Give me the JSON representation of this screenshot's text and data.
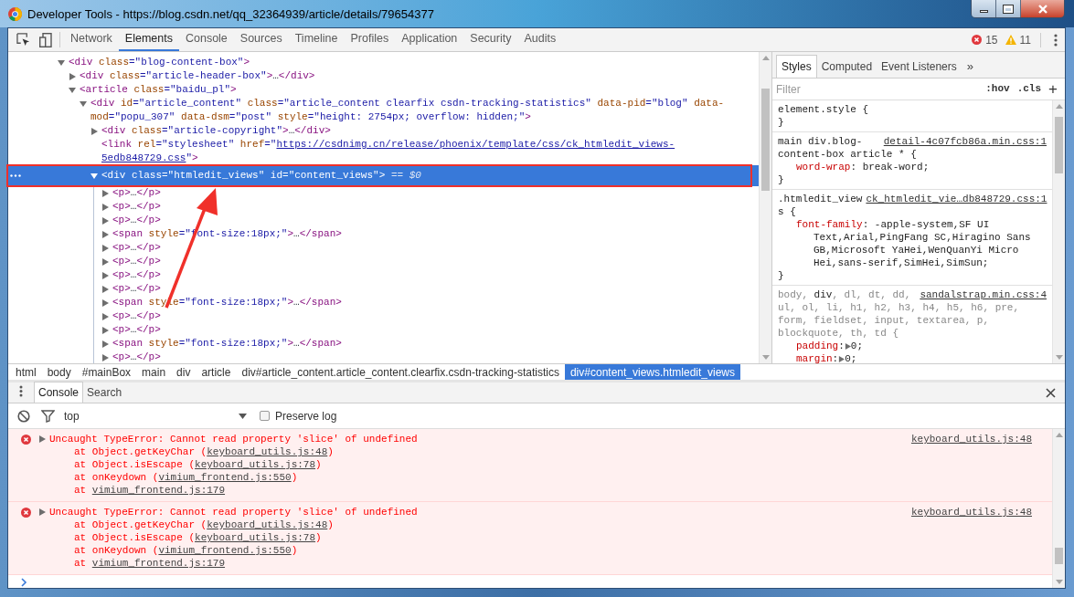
{
  "window": {
    "title": "Developer Tools - https://blog.csdn.net/qq_32364939/article/details/79654377"
  },
  "toolbar": {
    "tabs": [
      {
        "label": "Network",
        "selected": false
      },
      {
        "label": "Elements",
        "selected": true
      },
      {
        "label": "Console",
        "selected": false
      },
      {
        "label": "Sources",
        "selected": false
      },
      {
        "label": "Timeline",
        "selected": false
      },
      {
        "label": "Profiles",
        "selected": false
      },
      {
        "label": "Application",
        "selected": false
      },
      {
        "label": "Security",
        "selected": false
      },
      {
        "label": "Audits",
        "selected": false
      }
    ],
    "errors": "15",
    "warnings": "11"
  },
  "dom_tree": [
    {
      "expanded": true,
      "selected": false,
      "parts": [
        {
          "kind": "tag",
          "text": "<div"
        },
        {
          "kind": "attr",
          "text": " class"
        },
        {
          "kind": "value",
          "text": "=\"blog-content-box\""
        },
        {
          "kind": "tag",
          "text": ">"
        }
      ],
      "children": [
        {
          "expanded": false,
          "selected": false,
          "parts": [
            {
              "kind": "tag",
              "text": "<div"
            },
            {
              "kind": "attr",
              "text": " class"
            },
            {
              "kind": "value",
              "text": "=\"article-header-box\""
            },
            {
              "kind": "tag",
              "text": ">"
            },
            {
              "kind": "plain",
              "text": "…"
            },
            {
              "kind": "tag",
              "text": "</div>"
            }
          ]
        },
        {
          "expanded": true,
          "selected": false,
          "parts": [
            {
              "kind": "tag",
              "text": "<article"
            },
            {
              "kind": "attr",
              "text": " class"
            },
            {
              "kind": "value",
              "text": "=\"baidu_pl\""
            },
            {
              "kind": "tag",
              "text": ">"
            }
          ],
          "children": [
            {
              "expanded": true,
              "selected": false,
              "parts": [
                {
                  "kind": "tag",
                  "text": "<div"
                },
                {
                  "kind": "attr",
                  "text": " id"
                },
                {
                  "kind": "value",
                  "text": "=\"article_content\""
                },
                {
                  "kind": "attr",
                  "text": " class"
                },
                {
                  "kind": "value",
                  "text": "=\"article_content clearfix csdn-tracking-statistics\""
                },
                {
                  "kind": "attr",
                  "text": " data-pid"
                },
                {
                  "kind": "value",
                  "text": "=\"blog\""
                },
                {
                  "kind": "attr",
                  "text": " data-mod"
                },
                {
                  "kind": "value",
                  "text": "=\"popu_307\""
                },
                {
                  "kind": "attr",
                  "text": " data-dsm"
                },
                {
                  "kind": "value",
                  "text": "=\"post\""
                },
                {
                  "kind": "attr",
                  "text": " style"
                },
                {
                  "kind": "value",
                  "text": "=\"height: 2754px; overflow: hidden;\""
                },
                {
                  "kind": "tag",
                  "text": ">"
                }
              ],
              "children": [
                {
                  "expanded": false,
                  "selected": false,
                  "parts": [
                    {
                      "kind": "tag",
                      "text": "<div"
                    },
                    {
                      "kind": "attr",
                      "text": " class"
                    },
                    {
                      "kind": "value",
                      "text": "=\"article-copyright\""
                    },
                    {
                      "kind": "tag",
                      "text": ">"
                    },
                    {
                      "kind": "plain",
                      "text": "…"
                    },
                    {
                      "kind": "tag",
                      "text": "</div>"
                    }
                  ]
                },
                {
                  "selected": false,
                  "parts": [
                    {
                      "kind": "tag",
                      "text": "<link"
                    },
                    {
                      "kind": "attr",
                      "text": " rel"
                    },
                    {
                      "kind": "value",
                      "text": "=\"stylesheet\""
                    },
                    {
                      "kind": "attr",
                      "text": " href"
                    },
                    {
                      "kind": "value",
                      "text": "=\""
                    },
                    {
                      "kind": "url",
                      "text": "https://csdnimg.cn/release/phoenix/template/css/ck_htmledit_views-5edb848729.css"
                    },
                    {
                      "kind": "value",
                      "text": "\""
                    },
                    {
                      "kind": "tag",
                      "text": ">"
                    }
                  ]
                },
                {
                  "expanded": true,
                  "selected": true,
                  "parts": [
                    {
                      "kind": "tag",
                      "text": "<div"
                    },
                    {
                      "kind": "attr",
                      "text": " class"
                    },
                    {
                      "kind": "value",
                      "text": "=\"htmledit_views\""
                    },
                    {
                      "kind": "attr",
                      "text": " id"
                    },
                    {
                      "kind": "value",
                      "text": "=\"content_views\""
                    },
                    {
                      "kind": "tag",
                      "text": ">"
                    },
                    {
                      "kind": "marker",
                      "text": " == $0"
                    }
                  ],
                  "children": [
                    {
                      "expanded": false,
                      "selected": false,
                      "parts": [
                        {
                          "kind": "tag",
                          "text": "<p>"
                        },
                        {
                          "kind": "plain",
                          "text": "…"
                        },
                        {
                          "kind": "tag",
                          "text": "</p>"
                        }
                      ]
                    },
                    {
                      "expanded": false,
                      "selected": false,
                      "parts": [
                        {
                          "kind": "tag",
                          "text": "<p>"
                        },
                        {
                          "kind": "plain",
                          "text": "…"
                        },
                        {
                          "kind": "tag",
                          "text": "</p>"
                        }
                      ]
                    },
                    {
                      "expanded": false,
                      "selected": false,
                      "parts": [
                        {
                          "kind": "tag",
                          "text": "<p>"
                        },
                        {
                          "kind": "plain",
                          "text": "…"
                        },
                        {
                          "kind": "tag",
                          "text": "</p>"
                        }
                      ]
                    },
                    {
                      "expanded": false,
                      "selected": false,
                      "parts": [
                        {
                          "kind": "tag",
                          "text": "<span"
                        },
                        {
                          "kind": "attr",
                          "text": " style"
                        },
                        {
                          "kind": "value",
                          "text": "=\"font-size:18px;\""
                        },
                        {
                          "kind": "tag",
                          "text": ">"
                        },
                        {
                          "kind": "plain",
                          "text": "…"
                        },
                        {
                          "kind": "tag",
                          "text": "</span>"
                        }
                      ]
                    },
                    {
                      "expanded": false,
                      "selected": false,
                      "parts": [
                        {
                          "kind": "tag",
                          "text": "<p>"
                        },
                        {
                          "kind": "plain",
                          "text": "…"
                        },
                        {
                          "kind": "tag",
                          "text": "</p>"
                        }
                      ]
                    },
                    {
                      "expanded": false,
                      "selected": false,
                      "parts": [
                        {
                          "kind": "tag",
                          "text": "<p>"
                        },
                        {
                          "kind": "plain",
                          "text": "…"
                        },
                        {
                          "kind": "tag",
                          "text": "</p>"
                        }
                      ]
                    },
                    {
                      "expanded": false,
                      "selected": false,
                      "parts": [
                        {
                          "kind": "tag",
                          "text": "<p>"
                        },
                        {
                          "kind": "plain",
                          "text": "…"
                        },
                        {
                          "kind": "tag",
                          "text": "</p>"
                        }
                      ]
                    },
                    {
                      "expanded": false,
                      "selected": false,
                      "parts": [
                        {
                          "kind": "tag",
                          "text": "<p>"
                        },
                        {
                          "kind": "plain",
                          "text": "…"
                        },
                        {
                          "kind": "tag",
                          "text": "</p>"
                        }
                      ]
                    },
                    {
                      "expanded": false,
                      "selected": false,
                      "parts": [
                        {
                          "kind": "tag",
                          "text": "<span"
                        },
                        {
                          "kind": "attr",
                          "text": " style"
                        },
                        {
                          "kind": "value",
                          "text": "=\"font-size:18px;\""
                        },
                        {
                          "kind": "tag",
                          "text": ">"
                        },
                        {
                          "kind": "plain",
                          "text": "…"
                        },
                        {
                          "kind": "tag",
                          "text": "</span>"
                        }
                      ]
                    },
                    {
                      "expanded": false,
                      "selected": false,
                      "parts": [
                        {
                          "kind": "tag",
                          "text": "<p>"
                        },
                        {
                          "kind": "plain",
                          "text": "…"
                        },
                        {
                          "kind": "tag",
                          "text": "</p>"
                        }
                      ]
                    },
                    {
                      "expanded": false,
                      "selected": false,
                      "parts": [
                        {
                          "kind": "tag",
                          "text": "<p>"
                        },
                        {
                          "kind": "plain",
                          "text": "…"
                        },
                        {
                          "kind": "tag",
                          "text": "</p>"
                        }
                      ]
                    },
                    {
                      "expanded": false,
                      "selected": false,
                      "parts": [
                        {
                          "kind": "tag",
                          "text": "<span"
                        },
                        {
                          "kind": "attr",
                          "text": " style"
                        },
                        {
                          "kind": "value",
                          "text": "=\"font-size:18px;\""
                        },
                        {
                          "kind": "tag",
                          "text": ">"
                        },
                        {
                          "kind": "plain",
                          "text": "…"
                        },
                        {
                          "kind": "tag",
                          "text": "</span>"
                        }
                      ]
                    },
                    {
                      "expanded": false,
                      "selected": false,
                      "parts": [
                        {
                          "kind": "tag",
                          "text": "<p>"
                        },
                        {
                          "kind": "plain",
                          "text": "…"
                        },
                        {
                          "kind": "tag",
                          "text": "</p>"
                        }
                      ]
                    }
                  ]
                }
              ]
            }
          ]
        }
      ]
    }
  ],
  "breadcrumbs": [
    {
      "label": "html",
      "selected": false
    },
    {
      "label": "body",
      "selected": false
    },
    {
      "label": "#mainBox",
      "selected": false
    },
    {
      "label": "main",
      "selected": false
    },
    {
      "label": "div",
      "selected": false
    },
    {
      "label": "article",
      "selected": false
    },
    {
      "label": "div#article_content.article_content.clearfix.csdn-tracking-statistics",
      "selected": false
    },
    {
      "label": "div#content_views.htmledit_views",
      "selected": true
    }
  ],
  "styles": {
    "tabs": [
      {
        "label": "Styles",
        "selected": true
      },
      {
        "label": "Computed",
        "selected": false
      },
      {
        "label": "Event Listeners",
        "selected": false
      }
    ],
    "more": "»",
    "filter_placeholder": "Filter",
    "hov": ":hov",
    "cls": ".cls",
    "add": "+",
    "rules": [
      {
        "selector": [
          {
            "text": "element.style {",
            "matched": true
          }
        ],
        "close": "}"
      },
      {
        "source": "detail-4c07fcb86a.min.css:1",
        "selector": [
          {
            "text": "main div.blog-",
            "matched": true
          }
        ],
        "selector_tail": [
          {
            "text": "content-box article * {",
            "matched": true
          }
        ],
        "close": "}",
        "properties": [
          {
            "kind": "plain",
            "name": "word-wrap",
            "sep": ": ",
            "value": "break-word;"
          }
        ]
      },
      {
        "source": "ck_htmledit_vie…db848729.css:1",
        "selector": [
          {
            "text": ".htmledit_view",
            "matched": true
          }
        ],
        "selector_tail": [
          {
            "text": "s {",
            "matched": true
          }
        ],
        "close": "}",
        "properties": [
          {
            "kind": "plain",
            "name": "font-family",
            "sep": ": ",
            "value": "-apple-system,SF UI Text,Arial,PingFang SC,Hiragino Sans GB,Microsoft YaHei,WenQuanYi Micro Hei,sans-serif,SimHei,SimSun;"
          }
        ]
      },
      {
        "source": "sandalstrap.min.css:4",
        "selector": [
          {
            "text": "body, ",
            "matched": false
          },
          {
            "text": "div",
            "matched": true
          },
          {
            "text": ", dl, dt, dd,",
            "matched": false
          }
        ],
        "selector_tail": [
          {
            "text": "ul, ol, li, h1, h2, h3, h4, h5, h6, pre, form, fieldset, input, textarea, p, blockquote, th, td {",
            "matched": false
          }
        ],
        "properties": [
          {
            "kind": "shorthand",
            "name": "padding",
            "sep": ":",
            "value": "0;"
          },
          {
            "kind": "shorthand",
            "name": "margin",
            "sep": ":",
            "value": "0;"
          }
        ]
      }
    ]
  },
  "drawer": {
    "tabs": [
      {
        "label": "Console",
        "selected": true
      },
      {
        "label": "Search",
        "selected": false
      }
    ],
    "context": "top",
    "preserve_log": {
      "label": "Preserve log",
      "checked": false
    },
    "messages": [
      {
        "kind": "error",
        "expanded": false,
        "text": "Uncaught TypeError: Cannot read property 'slice' of undefined",
        "source": "keyboard_utils.js:48",
        "frames": [
          {
            "text": "at Object.getKeyChar (",
            "link": "keyboard_utils.js:48",
            "end": ")"
          },
          {
            "text": "at Object.isEscape (",
            "link": "keyboard_utils.js:78",
            "end": ")"
          },
          {
            "text": "at onKeydown (",
            "link": "vimium_frontend.js:550",
            "end": ")"
          },
          {
            "text": "at ",
            "link": "vimium_frontend.js:179"
          }
        ]
      },
      {
        "kind": "error",
        "expanded": false,
        "text": "Uncaught TypeError: Cannot read property 'slice' of undefined",
        "source": "keyboard_utils.js:48",
        "frames": [
          {
            "text": "at Object.getKeyChar (",
            "link": "keyboard_utils.js:48",
            "end": ")"
          },
          {
            "text": "at Object.isEscape (",
            "link": "keyboard_utils.js:78",
            "end": ")"
          },
          {
            "text": "at onKeydown (",
            "link": "vimium_frontend.js:550",
            "end": ")"
          },
          {
            "text": "at ",
            "link": "vimium_frontend.js:179"
          }
        ]
      }
    ]
  }
}
